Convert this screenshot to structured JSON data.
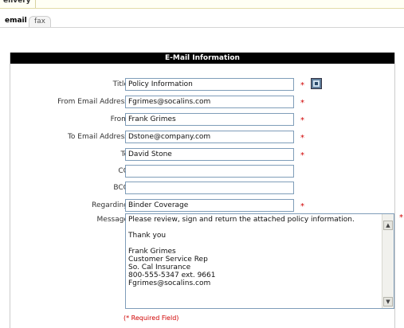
{
  "top_tab": {
    "label": "elivery"
  },
  "tabs": [
    {
      "label": "email",
      "active": true
    },
    {
      "label": "fax",
      "active": false
    }
  ],
  "panel": {
    "title": "E-Mail Information"
  },
  "fields": {
    "title": {
      "label": "Title:",
      "value": "Policy Information",
      "required": "*"
    },
    "from_email": {
      "label": "From Email Address:",
      "value": "Fgrimes@socalins.com",
      "required": "*"
    },
    "from": {
      "label": "From:",
      "value": "Frank Grimes",
      "required": "*"
    },
    "to_email": {
      "label": "To Email Address:",
      "value": "Dstone@company.com",
      "required": "*"
    },
    "to": {
      "label": "To:",
      "value": "David Stone",
      "required": "*"
    },
    "cc": {
      "label": "CC:",
      "value": ""
    },
    "bcc": {
      "label": "BCC:",
      "value": ""
    },
    "regarding": {
      "label": "Regarding:",
      "value": "Binder Coverage",
      "required": "*"
    }
  },
  "message": {
    "label": "Message:",
    "required": "*",
    "text": "Please review, sign and return the attached policy information.\n\nThank you\n\nFrank Grimes\nCustomer Service Rep\nSo. Cal Insurance\n800-555-5347 ext. 9661\nFgrimes@socalins.com"
  },
  "required_note": "(* Required Field)",
  "colors": {
    "required": "#d00000",
    "header_bg": "#000000",
    "field_border": "#7f9db9"
  },
  "icons": {
    "lookup": "address-book-icon"
  }
}
